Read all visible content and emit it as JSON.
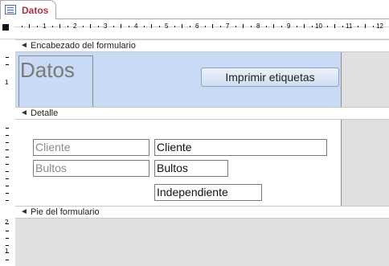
{
  "tab": {
    "title": "Datos",
    "icon": "form-icon"
  },
  "ruler": {
    "marks": [
      "1",
      "2",
      "3",
      "4",
      "5",
      "6",
      "7",
      "8",
      "9",
      "10",
      "11",
      "12"
    ]
  },
  "vruler": {
    "header_mark": "1",
    "detail_mark": "2",
    "footer_mark": "1"
  },
  "sections": {
    "header": {
      "label": "Encabezado del formulario",
      "background": "#c9daf4"
    },
    "detail": {
      "label": "Detalle"
    },
    "footer": {
      "label": "Pie del formulario"
    }
  },
  "header": {
    "title": "Datos",
    "print_button": "Imprimir etiquetas"
  },
  "detail": {
    "cliente_label": "Cliente",
    "cliente_field": "Cliente",
    "bultos_label": "Bultos",
    "bultos_field": "Bultos",
    "independiente_field": "Independiente"
  },
  "colors": {
    "tab_text": "#b0303c",
    "canvas_gray": "#e0e0e0"
  }
}
